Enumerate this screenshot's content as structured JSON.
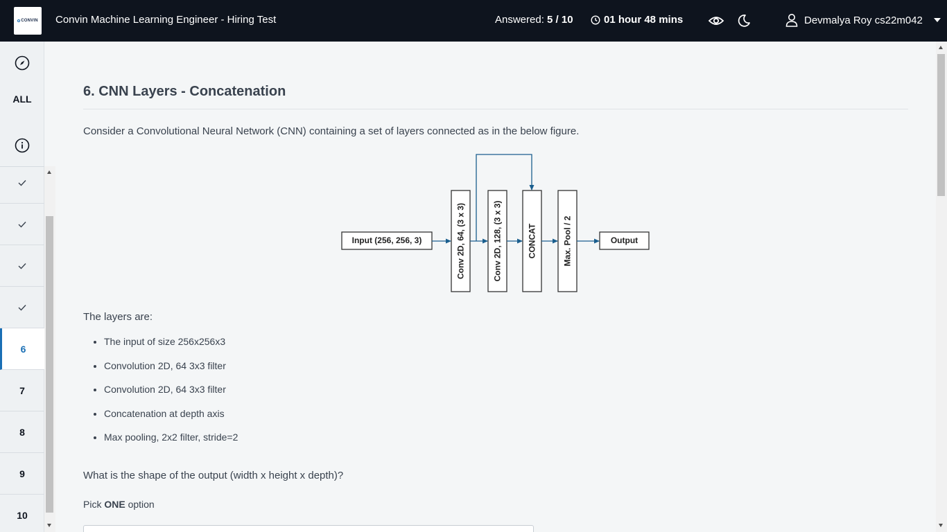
{
  "header": {
    "logo_text": "CONVIN",
    "title": "Convin Machine Learning Engineer - Hiring Test",
    "answered_label": "Answered:",
    "answered_value": "5 / 10",
    "timer": "01 hour 48 mins",
    "user_name": "Devmalya Roy cs22m042",
    "icons": [
      "clock-icon",
      "eye-icon",
      "moon-icon",
      "user-icon",
      "chevron-down-icon"
    ]
  },
  "sidebar": {
    "all_label": "ALL",
    "icons": [
      "compass-icon",
      "info-icon"
    ],
    "questions": [
      {
        "label": "✓",
        "status": "answered"
      },
      {
        "label": "✓",
        "status": "answered"
      },
      {
        "label": "✓",
        "status": "answered"
      },
      {
        "label": "✓",
        "status": "answered"
      },
      {
        "label": "6",
        "status": "current"
      },
      {
        "label": "7",
        "status": "pending"
      },
      {
        "label": "8",
        "status": "pending"
      },
      {
        "label": "9",
        "status": "pending"
      },
      {
        "label": "10",
        "status": "pending"
      }
    ]
  },
  "question": {
    "title": "6. CNN Layers - Concatenation",
    "intro": "Consider a Convolutional Neural Network (CNN) containing a set of layers connected as in the below figure.",
    "figure": {
      "input": "Input (256, 256, 3)",
      "conv1": "Conv 2D, 64, (3 x 3)",
      "conv2": "Conv 2D, 128, (3 x 3)",
      "concat": "CONCAT",
      "pool": "Max. Pool / 2",
      "output": "Output",
      "arrow_color": "#1a5e8e"
    },
    "layers_heading": "The layers are:",
    "layers": [
      "The input of size 256x256x3",
      "Convolution 2D, 64 3x3 filter",
      "Convolution 2D, 64 3x3 filter",
      "Concatenation at depth axis",
      "Max pooling, 2x2 filter, stride=2"
    ],
    "prompt": "What is the shape of the output (width x height x depth)?",
    "pick_prefix": "Pick ",
    "pick_bold": "ONE",
    "pick_suffix": " option"
  },
  "colors": {
    "header_bg": "#0e141e",
    "accent": "#1a6fb5",
    "text": "#39424e"
  }
}
